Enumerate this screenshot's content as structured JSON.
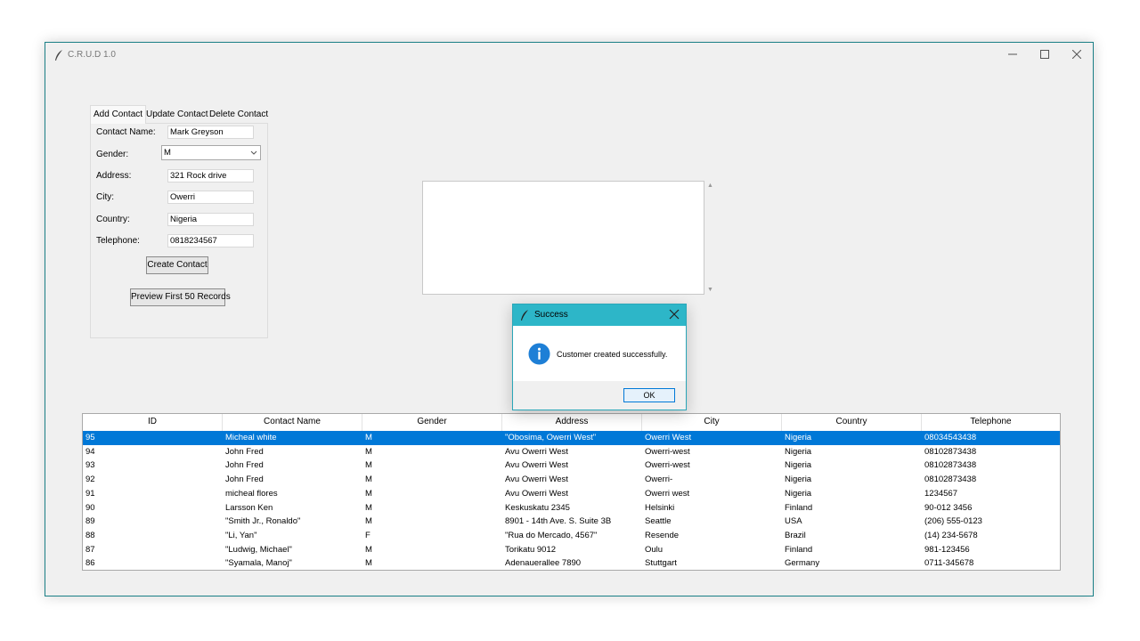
{
  "window": {
    "title": "C.R.U.D 1.0"
  },
  "tabs": [
    {
      "label": "Add Contact"
    },
    {
      "label": "Update Contact"
    },
    {
      "label": "Delete Contact"
    }
  ],
  "form": {
    "contact_name": {
      "label": "Contact Name:",
      "value": "Mark Greyson"
    },
    "gender": {
      "label": "Gender:",
      "value": "M"
    },
    "address": {
      "label": "Address:",
      "value": "321 Rock drive"
    },
    "city": {
      "label": "City:",
      "value": "Owerri"
    },
    "country": {
      "label": "Country:",
      "value": "Nigeria"
    },
    "telephone": {
      "label": "Telephone:",
      "value": "0818234567"
    },
    "create_button": "Create Contact",
    "preview_button": "Preview First 50 Records"
  },
  "table": {
    "columns": [
      "ID",
      "Contact Name",
      "Gender",
      "Address",
      "City",
      "Country",
      "Telephone"
    ],
    "rows": [
      [
        "95",
        "Micheal white",
        "M",
        "\"Obosima, Owerri West\"",
        "Owerri West",
        "Nigeria",
        "08034543438"
      ],
      [
        "94",
        "John Fred",
        "M",
        "Avu Owerri West",
        "Owerri-west",
        "Nigeria",
        "08102873438"
      ],
      [
        "93",
        "John Fred",
        "M",
        "Avu Owerri West",
        "Owerri-west",
        "Nigeria",
        "08102873438"
      ],
      [
        "92",
        "John Fred",
        "M",
        "Avu Owerri West",
        "Owerri-",
        "Nigeria",
        "08102873438"
      ],
      [
        "91",
        "micheal flores",
        "M",
        "Avu Owerri West",
        "Owerri west",
        "Nigeria",
        "1234567"
      ],
      [
        "90",
        "Larsson Ken",
        "M",
        "Keskuskatu 2345",
        "Helsinki",
        "Finland",
        "90-012 3456"
      ],
      [
        "89",
        "\"Smith Jr., Ronaldo\"",
        "M",
        "8901 - 14th Ave. S. Suite 3B",
        "Seattle",
        "USA",
        "(206) 555-0123"
      ],
      [
        "88",
        "\"Li, Yan\"",
        "F",
        "\"Rua do Mercado, 4567\"",
        "Resende",
        "Brazil",
        "(14) 234-5678"
      ],
      [
        "87",
        "\"Ludwig, Michael\"",
        "M",
        "Torikatu 9012",
        "Oulu",
        "Finland",
        "981-123456"
      ],
      [
        "86",
        "\"Syamala, Manoj\"",
        "M",
        "Adenauerallee 7890",
        "Stuttgart",
        "Germany",
        "0711-345678"
      ]
    ]
  },
  "dialog": {
    "title": "Success",
    "message": "Customer created successfully.",
    "ok_label": "OK"
  },
  "colors": {
    "selection": "#0078d7",
    "dialog_titlebar": "#2db6c8",
    "info_icon": "#1e7fd6"
  }
}
